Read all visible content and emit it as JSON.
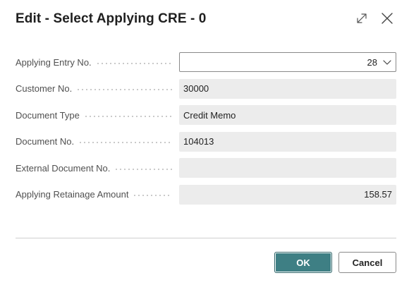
{
  "dialog": {
    "title": "Edit - Select Applying CRE - 0",
    "expand_icon": "expand-icon",
    "close_icon": "close-icon"
  },
  "fields": [
    {
      "label": "Applying Entry No.",
      "value": "28",
      "type": "dropdown"
    },
    {
      "label": "Customer No.",
      "value": "30000",
      "type": "readonly"
    },
    {
      "label": "Document Type",
      "value": "Credit Memo",
      "type": "readonly"
    },
    {
      "label": "Document No.",
      "value": "104013",
      "type": "readonly"
    },
    {
      "label": "External Document No.",
      "value": "",
      "type": "readonly"
    },
    {
      "label": "Applying Retainage Amount",
      "value": "158.57",
      "type": "readonly-number"
    }
  ],
  "buttons": {
    "ok_label": "OK",
    "cancel_label": "Cancel"
  },
  "colors": {
    "primary_button": "#3e7f84",
    "readonly_field_bg": "#ececec"
  }
}
